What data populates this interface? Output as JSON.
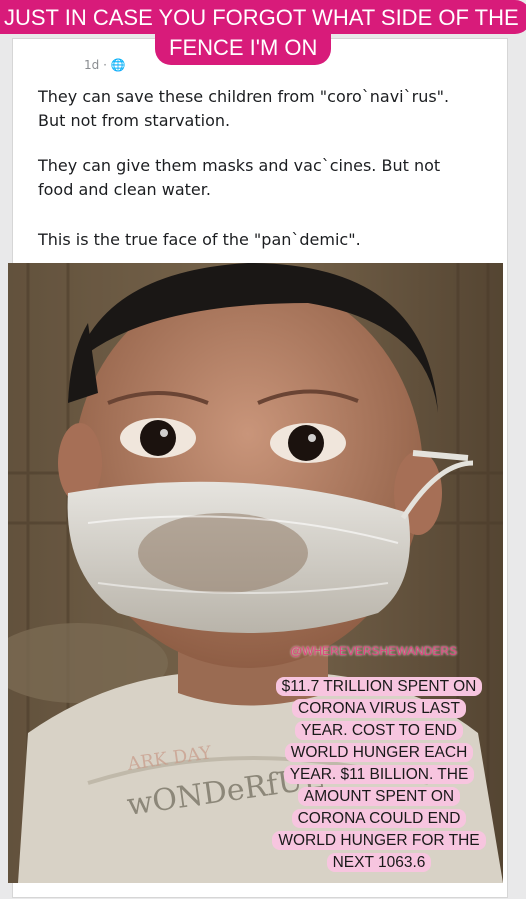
{
  "banner": {
    "line1": "JUST IN CASE YOU FORGOT WHAT SIDE OF THE",
    "line2": "FENCE I'M ON"
  },
  "post": {
    "meta": "1d · ",
    "paragraphs": [
      "They can save these children from \"coro`navi`rus\". But not from starvation.",
      "They can give them masks and vac`cines. But not food and clean water.",
      "This is the true face of the \"pan`demic\"."
    ]
  },
  "photo": {
    "watermark": "@WHEREVERSHEWANDERS",
    "shirt_text": "wONDeRfUL",
    "caption": "$11.7 TRILLION SPENT ON CORONA VIRUS LAST YEAR. COST TO END WORLD HUNGER EACH YEAR. $11 BILLION. THE AMOUNT SPENT ON CORONA COULD END WORLD HUNGER FOR THE NEXT 1063.6"
  },
  "colors": {
    "banner_bg": "#d81b7a",
    "caption_bg": "#f7c5df",
    "watermark": "#e0437f"
  }
}
